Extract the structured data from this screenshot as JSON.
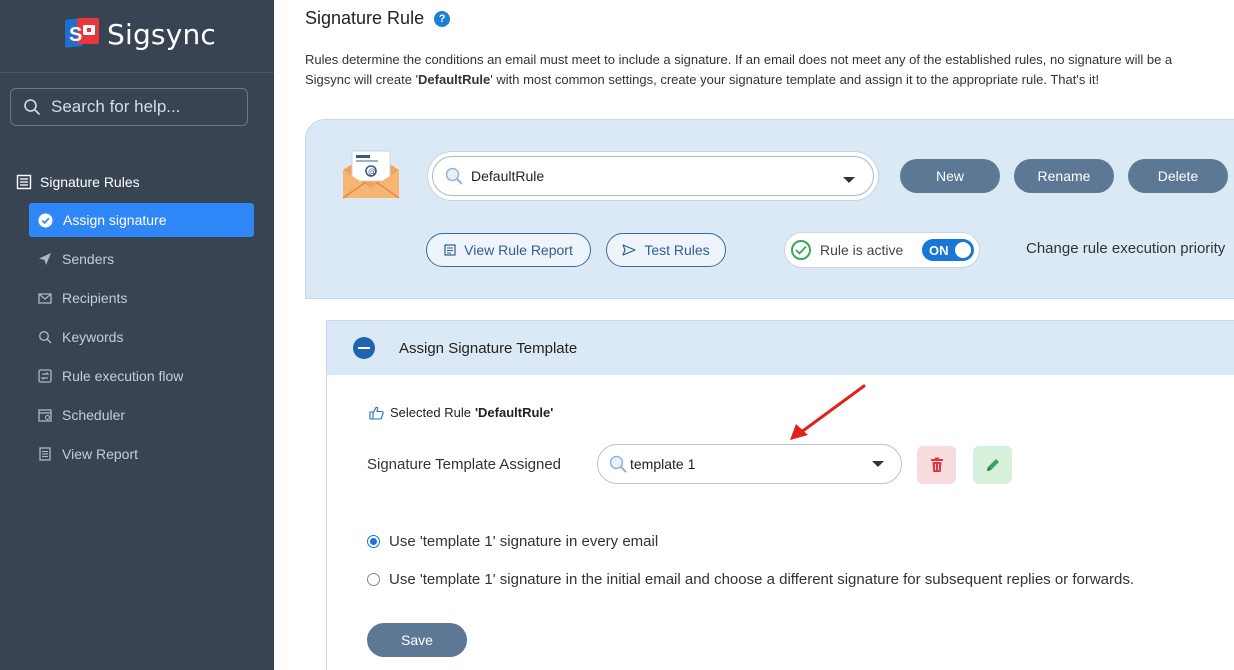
{
  "brand": {
    "name": "Sigsync"
  },
  "search": {
    "placeholder": "Search for help..."
  },
  "sidebar": {
    "section_title": "Signature Rules",
    "items": [
      {
        "label": "Assign signature",
        "icon": "check-circle-icon",
        "active": true
      },
      {
        "label": "Senders",
        "icon": "send-icon"
      },
      {
        "label": "Recipients",
        "icon": "recipients-icon"
      },
      {
        "label": "Keywords",
        "icon": "search-icon"
      },
      {
        "label": "Rule execution flow",
        "icon": "flow-icon"
      },
      {
        "label": "Scheduler",
        "icon": "calendar-icon"
      },
      {
        "label": "View Report",
        "icon": "report-icon"
      }
    ]
  },
  "page": {
    "title": "Signature Rule",
    "description_line1": "Rules determine the conditions an email must meet to include a signature. If an email does not meet any of the established rules, no signature will be a",
    "description_line2_a": "Sigsync will create '",
    "description_line2_bold": "DefaultRule",
    "description_line2_b": "' with most common settings, create your signature template and assign it to the appropriate rule. That's it!"
  },
  "rule_toolbar": {
    "selected_rule": "DefaultRule",
    "new_label": "New",
    "rename_label": "Rename",
    "delete_label": "Delete",
    "view_report_label": "View Rule Report",
    "test_rules_label": "Test Rules",
    "rule_active_label": "Rule is active",
    "toggle_state": "ON",
    "priority_label": "Change rule execution priority"
  },
  "assign_section": {
    "title": "Assign Signature Template",
    "selected_rule_label": "Selected Rule",
    "selected_rule_value": "'DefaultRule'",
    "template_label": "Signature Template Assigned",
    "template_value": "template 1",
    "option_every_email": "Use 'template 1' signature in every email",
    "option_initial_email": "Use 'template 1' signature in the initial email and choose a different signature for subsequent replies or forwards.",
    "save_label": "Save"
  },
  "colors": {
    "sidebar_bg": "#394453",
    "active_item": "#2f86f6",
    "panel_bg": "#dbe9f6",
    "button_bg": "#5c7894",
    "toggle_on": "#1677d6",
    "annotation_arrow": "#e3201b"
  }
}
